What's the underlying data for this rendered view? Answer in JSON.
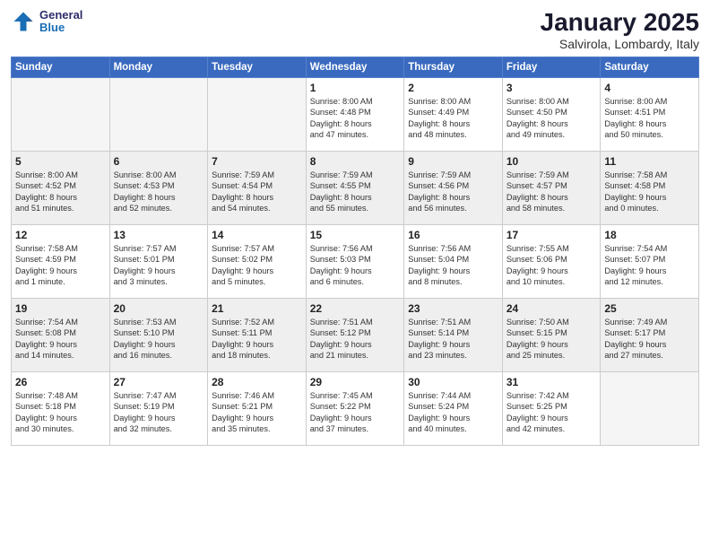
{
  "logo": {
    "general": "General",
    "blue": "Blue"
  },
  "title": "January 2025",
  "subtitle": "Salvirola, Lombardy, Italy",
  "days_header": [
    "Sunday",
    "Monday",
    "Tuesday",
    "Wednesday",
    "Thursday",
    "Friday",
    "Saturday"
  ],
  "weeks": [
    [
      {
        "day": "",
        "text": ""
      },
      {
        "day": "",
        "text": ""
      },
      {
        "day": "",
        "text": ""
      },
      {
        "day": "1",
        "text": "Sunrise: 8:00 AM\nSunset: 4:48 PM\nDaylight: 8 hours\nand 47 minutes."
      },
      {
        "day": "2",
        "text": "Sunrise: 8:00 AM\nSunset: 4:49 PM\nDaylight: 8 hours\nand 48 minutes."
      },
      {
        "day": "3",
        "text": "Sunrise: 8:00 AM\nSunset: 4:50 PM\nDaylight: 8 hours\nand 49 minutes."
      },
      {
        "day": "4",
        "text": "Sunrise: 8:00 AM\nSunset: 4:51 PM\nDaylight: 8 hours\nand 50 minutes."
      }
    ],
    [
      {
        "day": "5",
        "text": "Sunrise: 8:00 AM\nSunset: 4:52 PM\nDaylight: 8 hours\nand 51 minutes."
      },
      {
        "day": "6",
        "text": "Sunrise: 8:00 AM\nSunset: 4:53 PM\nDaylight: 8 hours\nand 52 minutes."
      },
      {
        "day": "7",
        "text": "Sunrise: 7:59 AM\nSunset: 4:54 PM\nDaylight: 8 hours\nand 54 minutes."
      },
      {
        "day": "8",
        "text": "Sunrise: 7:59 AM\nSunset: 4:55 PM\nDaylight: 8 hours\nand 55 minutes."
      },
      {
        "day": "9",
        "text": "Sunrise: 7:59 AM\nSunset: 4:56 PM\nDaylight: 8 hours\nand 56 minutes."
      },
      {
        "day": "10",
        "text": "Sunrise: 7:59 AM\nSunset: 4:57 PM\nDaylight: 8 hours\nand 58 minutes."
      },
      {
        "day": "11",
        "text": "Sunrise: 7:58 AM\nSunset: 4:58 PM\nDaylight: 9 hours\nand 0 minutes."
      }
    ],
    [
      {
        "day": "12",
        "text": "Sunrise: 7:58 AM\nSunset: 4:59 PM\nDaylight: 9 hours\nand 1 minute."
      },
      {
        "day": "13",
        "text": "Sunrise: 7:57 AM\nSunset: 5:01 PM\nDaylight: 9 hours\nand 3 minutes."
      },
      {
        "day": "14",
        "text": "Sunrise: 7:57 AM\nSunset: 5:02 PM\nDaylight: 9 hours\nand 5 minutes."
      },
      {
        "day": "15",
        "text": "Sunrise: 7:56 AM\nSunset: 5:03 PM\nDaylight: 9 hours\nand 6 minutes."
      },
      {
        "day": "16",
        "text": "Sunrise: 7:56 AM\nSunset: 5:04 PM\nDaylight: 9 hours\nand 8 minutes."
      },
      {
        "day": "17",
        "text": "Sunrise: 7:55 AM\nSunset: 5:06 PM\nDaylight: 9 hours\nand 10 minutes."
      },
      {
        "day": "18",
        "text": "Sunrise: 7:54 AM\nSunset: 5:07 PM\nDaylight: 9 hours\nand 12 minutes."
      }
    ],
    [
      {
        "day": "19",
        "text": "Sunrise: 7:54 AM\nSunset: 5:08 PM\nDaylight: 9 hours\nand 14 minutes."
      },
      {
        "day": "20",
        "text": "Sunrise: 7:53 AM\nSunset: 5:10 PM\nDaylight: 9 hours\nand 16 minutes."
      },
      {
        "day": "21",
        "text": "Sunrise: 7:52 AM\nSunset: 5:11 PM\nDaylight: 9 hours\nand 18 minutes."
      },
      {
        "day": "22",
        "text": "Sunrise: 7:51 AM\nSunset: 5:12 PM\nDaylight: 9 hours\nand 21 minutes."
      },
      {
        "day": "23",
        "text": "Sunrise: 7:51 AM\nSunset: 5:14 PM\nDaylight: 9 hours\nand 23 minutes."
      },
      {
        "day": "24",
        "text": "Sunrise: 7:50 AM\nSunset: 5:15 PM\nDaylight: 9 hours\nand 25 minutes."
      },
      {
        "day": "25",
        "text": "Sunrise: 7:49 AM\nSunset: 5:17 PM\nDaylight: 9 hours\nand 27 minutes."
      }
    ],
    [
      {
        "day": "26",
        "text": "Sunrise: 7:48 AM\nSunset: 5:18 PM\nDaylight: 9 hours\nand 30 minutes."
      },
      {
        "day": "27",
        "text": "Sunrise: 7:47 AM\nSunset: 5:19 PM\nDaylight: 9 hours\nand 32 minutes."
      },
      {
        "day": "28",
        "text": "Sunrise: 7:46 AM\nSunset: 5:21 PM\nDaylight: 9 hours\nand 35 minutes."
      },
      {
        "day": "29",
        "text": "Sunrise: 7:45 AM\nSunset: 5:22 PM\nDaylight: 9 hours\nand 37 minutes."
      },
      {
        "day": "30",
        "text": "Sunrise: 7:44 AM\nSunset: 5:24 PM\nDaylight: 9 hours\nand 40 minutes."
      },
      {
        "day": "31",
        "text": "Sunrise: 7:42 AM\nSunset: 5:25 PM\nDaylight: 9 hours\nand 42 minutes."
      },
      {
        "day": "",
        "text": ""
      }
    ]
  ]
}
